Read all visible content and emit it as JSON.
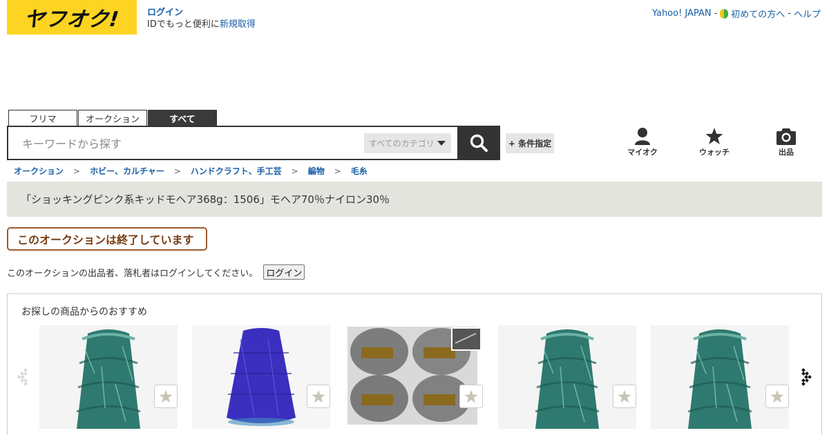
{
  "header": {
    "logo_text": "ヤフオク!",
    "login_label": "ログイン",
    "login_sub_prefix": "IDでもっと便利に",
    "register_label": "新規取得",
    "links": {
      "yahoo_japan": "Yahoo! JAPAN",
      "beginners": "初めての方へ",
      "help": "ヘルプ",
      "separator": "-"
    }
  },
  "tabs": [
    {
      "label": "フリマ",
      "active": false
    },
    {
      "label": "オークション",
      "active": false
    },
    {
      "label": "すべて",
      "active": true
    }
  ],
  "search": {
    "placeholder": "キーワードから探す",
    "category_label": "すべてのカテゴリ",
    "condition_label": "+ 条件指定"
  },
  "quick_icons": [
    {
      "label": "マイオク",
      "icon": "person-icon"
    },
    {
      "label": "ウォッチ",
      "icon": "star-icon"
    },
    {
      "label": "出品",
      "icon": "camera-icon"
    }
  ],
  "breadcrumb": [
    "オークション",
    "ホビー、カルチャー",
    "ハンドクラフト、手工芸",
    "編物",
    "毛糸"
  ],
  "breadcrumb_separator": ">",
  "item_title": "「ショッキングピンク系キッドモヘア368g：1506」モヘア70％ナイロン30％",
  "auction_status": "このオークションは終了しています",
  "login_note": {
    "text": "このオークションの出品者、落札者はログインしてください。",
    "button_label": "ログイン"
  },
  "recommendations": {
    "title": "お探しの商品からのおすすめ",
    "items": [
      {
        "thumbnail": "teal-mohair-cone",
        "color": "#2f7a70"
      },
      {
        "thumbnail": "blue-mohair-cone",
        "color": "#3b2fc0"
      },
      {
        "thumbnail": "yarn-balls-pack",
        "color": "#8a8a8a"
      },
      {
        "thumbnail": "teal-mohair-cone",
        "color": "#2f7a70"
      },
      {
        "thumbnail": "teal-mohair-cone",
        "color": "#2f7a70"
      }
    ]
  },
  "colors": {
    "brand_yellow": "#fcd421",
    "link_blue": "#1a5fa6",
    "title_bg": "#e4e4de",
    "badge_border": "#9c5a2c"
  }
}
